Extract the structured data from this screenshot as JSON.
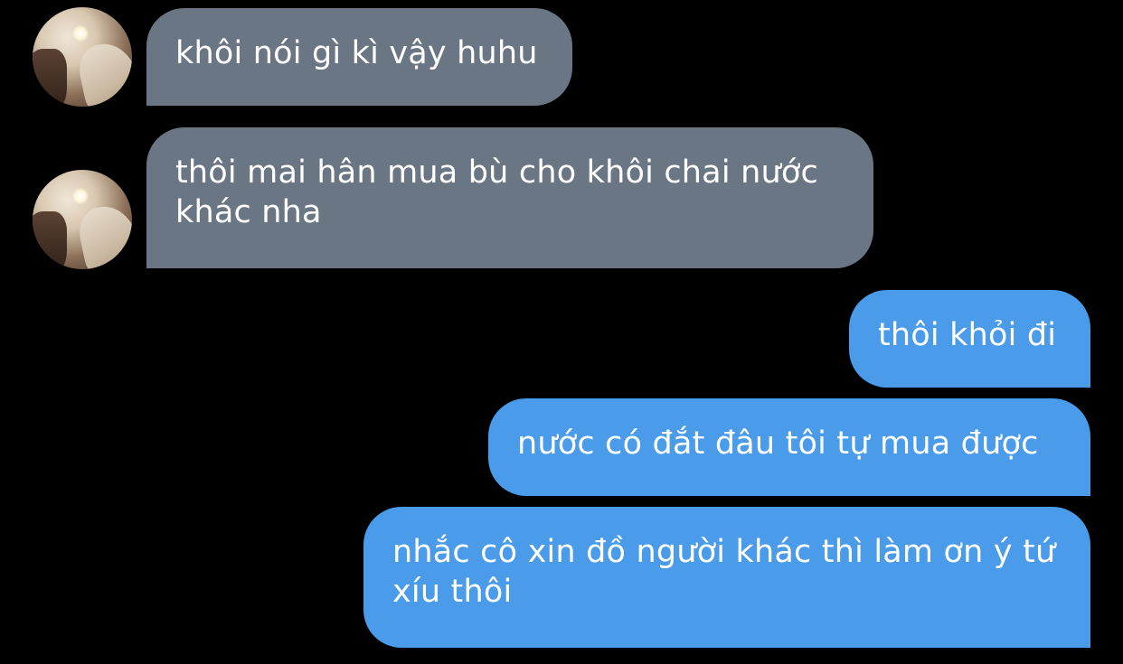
{
  "messages": [
    {
      "side": "incoming",
      "text": "khôi nói gì kì vậy huhu"
    },
    {
      "side": "incoming",
      "text": "thôi mai hân mua bù cho khôi chai nước khác nha"
    },
    {
      "side": "outgoing",
      "text": "thôi khỏi đi"
    },
    {
      "side": "outgoing",
      "text": "nước có đắt đâu tôi tự mua được"
    },
    {
      "side": "outgoing",
      "text": "nhắc cô xin đồ người khác thì làm ơn ý tứ xíu thôi"
    }
  ],
  "colors": {
    "background": "#000000",
    "incoming_bubble": "#6a7684",
    "outgoing_bubble": "#4a9be9",
    "text": "#ffffff"
  },
  "icons": {
    "avatar": "profile-photo"
  }
}
